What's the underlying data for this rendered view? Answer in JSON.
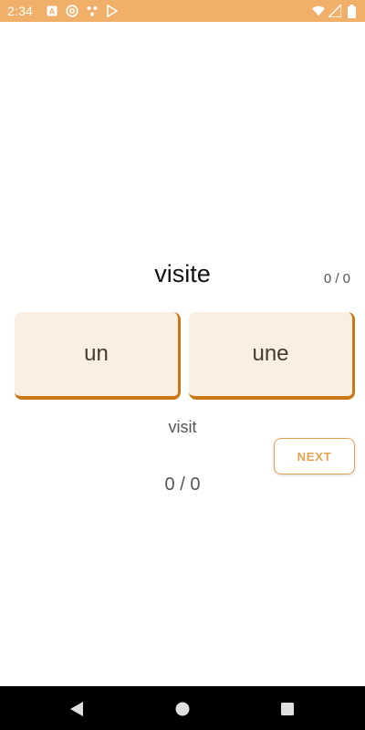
{
  "status_bar": {
    "time": "2:34",
    "background": "#f0b06a",
    "icons_left": [
      "a-text-icon",
      "at-sign-icon",
      "dots-icon",
      "play-store-icon"
    ],
    "icons_right": [
      "wifi-icon",
      "signal-icon",
      "battery-icon"
    ]
  },
  "quiz": {
    "word": "visite",
    "score_top": "0 / 0",
    "choices": [
      {
        "label": "un"
      },
      {
        "label": "une"
      }
    ],
    "translation": "visit",
    "next_label": "NEXT",
    "progress": "0 / 0",
    "accent_color": "#e3a34f",
    "choice_bg": "#f9efe3",
    "choice_shadow": "#c97818"
  },
  "nav_bar": {
    "buttons": [
      "back-icon",
      "home-icon",
      "recent-apps-icon"
    ]
  }
}
